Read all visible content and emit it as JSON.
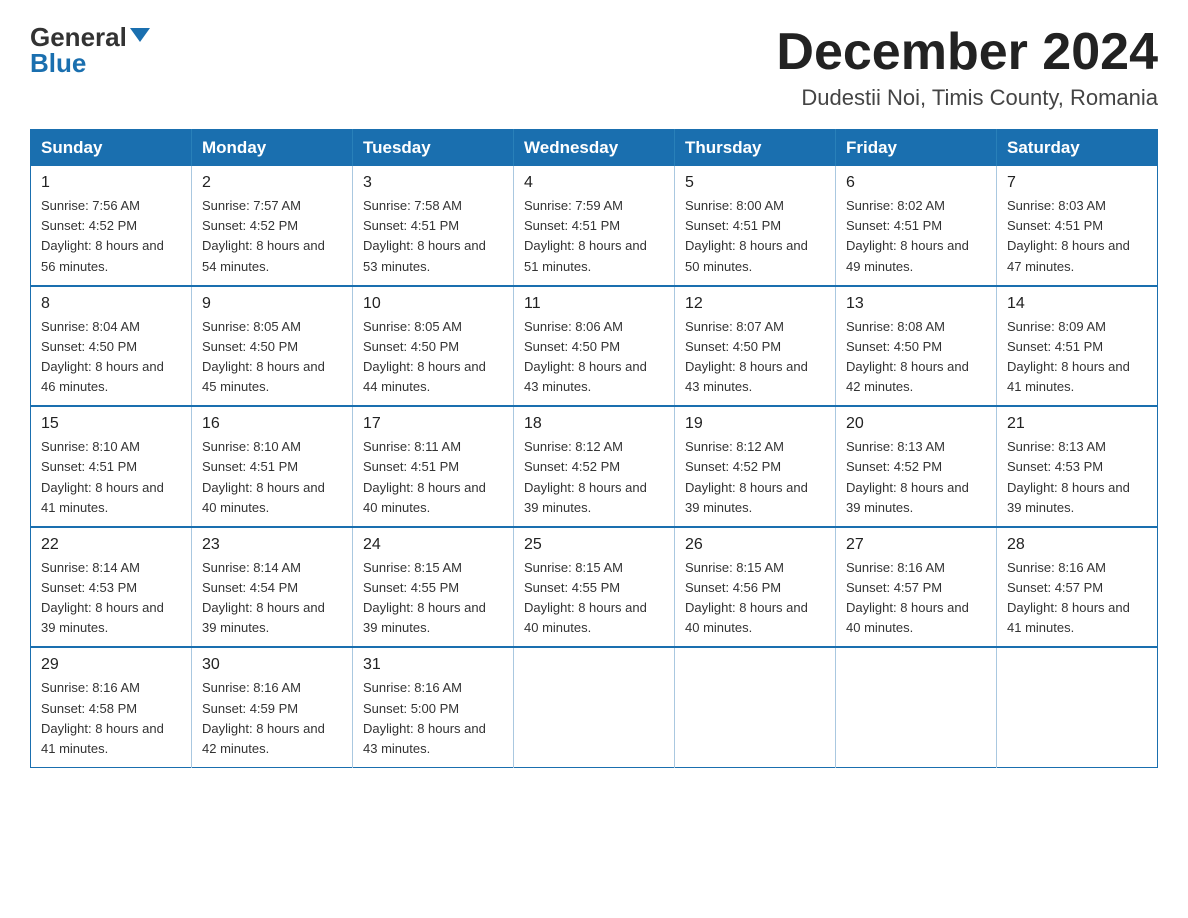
{
  "header": {
    "logo_general": "General",
    "logo_blue": "Blue",
    "month_title": "December 2024",
    "location": "Dudestii Noi, Timis County, Romania"
  },
  "weekdays": [
    "Sunday",
    "Monday",
    "Tuesday",
    "Wednesday",
    "Thursday",
    "Friday",
    "Saturday"
  ],
  "weeks": [
    [
      {
        "day": "1",
        "sunrise": "7:56 AM",
        "sunset": "4:52 PM",
        "daylight": "8 hours and 56 minutes."
      },
      {
        "day": "2",
        "sunrise": "7:57 AM",
        "sunset": "4:52 PM",
        "daylight": "8 hours and 54 minutes."
      },
      {
        "day": "3",
        "sunrise": "7:58 AM",
        "sunset": "4:51 PM",
        "daylight": "8 hours and 53 minutes."
      },
      {
        "day": "4",
        "sunrise": "7:59 AM",
        "sunset": "4:51 PM",
        "daylight": "8 hours and 51 minutes."
      },
      {
        "day": "5",
        "sunrise": "8:00 AM",
        "sunset": "4:51 PM",
        "daylight": "8 hours and 50 minutes."
      },
      {
        "day": "6",
        "sunrise": "8:02 AM",
        "sunset": "4:51 PM",
        "daylight": "8 hours and 49 minutes."
      },
      {
        "day": "7",
        "sunrise": "8:03 AM",
        "sunset": "4:51 PM",
        "daylight": "8 hours and 47 minutes."
      }
    ],
    [
      {
        "day": "8",
        "sunrise": "8:04 AM",
        "sunset": "4:50 PM",
        "daylight": "8 hours and 46 minutes."
      },
      {
        "day": "9",
        "sunrise": "8:05 AM",
        "sunset": "4:50 PM",
        "daylight": "8 hours and 45 minutes."
      },
      {
        "day": "10",
        "sunrise": "8:05 AM",
        "sunset": "4:50 PM",
        "daylight": "8 hours and 44 minutes."
      },
      {
        "day": "11",
        "sunrise": "8:06 AM",
        "sunset": "4:50 PM",
        "daylight": "8 hours and 43 minutes."
      },
      {
        "day": "12",
        "sunrise": "8:07 AM",
        "sunset": "4:50 PM",
        "daylight": "8 hours and 43 minutes."
      },
      {
        "day": "13",
        "sunrise": "8:08 AM",
        "sunset": "4:50 PM",
        "daylight": "8 hours and 42 minutes."
      },
      {
        "day": "14",
        "sunrise": "8:09 AM",
        "sunset": "4:51 PM",
        "daylight": "8 hours and 41 minutes."
      }
    ],
    [
      {
        "day": "15",
        "sunrise": "8:10 AM",
        "sunset": "4:51 PM",
        "daylight": "8 hours and 41 minutes."
      },
      {
        "day": "16",
        "sunrise": "8:10 AM",
        "sunset": "4:51 PM",
        "daylight": "8 hours and 40 minutes."
      },
      {
        "day": "17",
        "sunrise": "8:11 AM",
        "sunset": "4:51 PM",
        "daylight": "8 hours and 40 minutes."
      },
      {
        "day": "18",
        "sunrise": "8:12 AM",
        "sunset": "4:52 PM",
        "daylight": "8 hours and 39 minutes."
      },
      {
        "day": "19",
        "sunrise": "8:12 AM",
        "sunset": "4:52 PM",
        "daylight": "8 hours and 39 minutes."
      },
      {
        "day": "20",
        "sunrise": "8:13 AM",
        "sunset": "4:52 PM",
        "daylight": "8 hours and 39 minutes."
      },
      {
        "day": "21",
        "sunrise": "8:13 AM",
        "sunset": "4:53 PM",
        "daylight": "8 hours and 39 minutes."
      }
    ],
    [
      {
        "day": "22",
        "sunrise": "8:14 AM",
        "sunset": "4:53 PM",
        "daylight": "8 hours and 39 minutes."
      },
      {
        "day": "23",
        "sunrise": "8:14 AM",
        "sunset": "4:54 PM",
        "daylight": "8 hours and 39 minutes."
      },
      {
        "day": "24",
        "sunrise": "8:15 AM",
        "sunset": "4:55 PM",
        "daylight": "8 hours and 39 minutes."
      },
      {
        "day": "25",
        "sunrise": "8:15 AM",
        "sunset": "4:55 PM",
        "daylight": "8 hours and 40 minutes."
      },
      {
        "day": "26",
        "sunrise": "8:15 AM",
        "sunset": "4:56 PM",
        "daylight": "8 hours and 40 minutes."
      },
      {
        "day": "27",
        "sunrise": "8:16 AM",
        "sunset": "4:57 PM",
        "daylight": "8 hours and 40 minutes."
      },
      {
        "day": "28",
        "sunrise": "8:16 AM",
        "sunset": "4:57 PM",
        "daylight": "8 hours and 41 minutes."
      }
    ],
    [
      {
        "day": "29",
        "sunrise": "8:16 AM",
        "sunset": "4:58 PM",
        "daylight": "8 hours and 41 minutes."
      },
      {
        "day": "30",
        "sunrise": "8:16 AM",
        "sunset": "4:59 PM",
        "daylight": "8 hours and 42 minutes."
      },
      {
        "day": "31",
        "sunrise": "8:16 AM",
        "sunset": "5:00 PM",
        "daylight": "8 hours and 43 minutes."
      },
      null,
      null,
      null,
      null
    ]
  ]
}
